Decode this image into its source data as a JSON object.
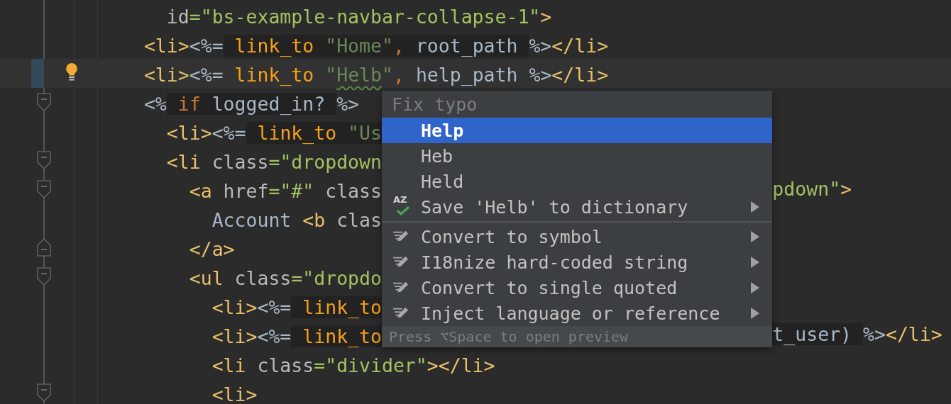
{
  "editor": {
    "lines": [
      {
        "current": false,
        "fold_open": false,
        "fold_close": false,
        "left": [
          {
            "text": "    id",
            "kind": "attr"
          },
          {
            "text": "=\"bs-example-navbar-collapse-1\"",
            "kind": "value"
          },
          {
            "text": ">",
            "kind": "tag"
          }
        ]
      },
      {
        "current": false,
        "fold_open": false,
        "fold_close": false,
        "left": [
          {
            "text": "  <li>",
            "kind": "tag"
          },
          {
            "text": "<%=",
            "kind": "punct"
          },
          {
            "text": " link_to",
            "kind": "ruby-method"
          },
          {
            "text": " \"Home\"",
            "kind": "ruby-string"
          },
          {
            "text": ",",
            "kind": "ruby-keyword"
          },
          {
            "text": " root_path ",
            "kind": "ruby-ident"
          },
          {
            "text": "%>",
            "kind": "punct"
          },
          {
            "text": "</li>",
            "kind": "tag"
          }
        ]
      },
      {
        "current": true,
        "fold_open": false,
        "fold_close": false,
        "left": [
          {
            "text": "  <li>",
            "kind": "tag"
          },
          {
            "text": "<%=",
            "kind": "punct"
          },
          {
            "text": " link_to",
            "kind": "method"
          },
          {
            "text": " \"",
            "kind": "string"
          },
          {
            "text": "Helb",
            "kind": "typo"
          },
          {
            "text": "\"",
            "kind": "string"
          },
          {
            "text": ",",
            "kind": "keyword"
          },
          {
            "text": " help_path ",
            "kind": "ident"
          },
          {
            "text": "%>",
            "kind": "punct"
          },
          {
            "text": "</li>",
            "kind": "tag"
          }
        ]
      },
      {
        "current": false,
        "fold_open": true,
        "fold_close": false,
        "left": [
          {
            "text": "  <%",
            "kind": "punct"
          },
          {
            "text": " if",
            "kind": "ruby-keyword"
          },
          {
            "text": " logged_in? ",
            "kind": "ruby-ident"
          },
          {
            "text": "%>",
            "kind": "punct"
          }
        ]
      },
      {
        "current": false,
        "fold_open": false,
        "fold_close": false,
        "left": [
          {
            "text": "    <li>",
            "kind": "tag"
          },
          {
            "text": "<%=",
            "kind": "punct"
          },
          {
            "text": " link_to",
            "kind": "ruby-method"
          },
          {
            "text": " \"Us",
            "kind": "ruby-string"
          }
        ]
      },
      {
        "current": false,
        "fold_open": true,
        "fold_close": false,
        "left": [
          {
            "text": "    <li",
            "kind": "tag"
          },
          {
            "text": " class",
            "kind": "attr"
          },
          {
            "text": "=\"dropdown",
            "kind": "value"
          }
        ]
      },
      {
        "current": false,
        "fold_open": true,
        "fold_close": false,
        "left": [
          {
            "text": "      <a",
            "kind": "tag"
          },
          {
            "text": " href",
            "kind": "attr"
          },
          {
            "text": "=\"#\"",
            "kind": "value"
          },
          {
            "text": " class",
            "kind": "attr"
          }
        ],
        "right": [
          {
            "text": "pdown\"",
            "kind": "value"
          },
          {
            "text": ">",
            "kind": "tag"
          }
        ]
      },
      {
        "current": false,
        "fold_open": false,
        "fold_close": false,
        "left": [
          {
            "text": "        Account",
            "kind": "ident"
          },
          {
            "text": " <b",
            "kind": "tag"
          },
          {
            "text": " clas",
            "kind": "attr"
          }
        ]
      },
      {
        "current": false,
        "fold_open": false,
        "fold_close": true,
        "left": [
          {
            "text": "      </a>",
            "kind": "tag"
          }
        ]
      },
      {
        "current": false,
        "fold_open": true,
        "fold_close": false,
        "left": [
          {
            "text": "      <ul",
            "kind": "tag"
          },
          {
            "text": " class",
            "kind": "attr"
          },
          {
            "text": "=\"dropdo",
            "kind": "value"
          }
        ]
      },
      {
        "current": false,
        "fold_open": false,
        "fold_close": false,
        "left": [
          {
            "text": "        <li>",
            "kind": "tag"
          },
          {
            "text": "<%=",
            "kind": "punct"
          },
          {
            "text": " link_to",
            "kind": "ruby-method"
          }
        ]
      },
      {
        "current": false,
        "fold_open": false,
        "fold_close": false,
        "left": [
          {
            "text": "        <li>",
            "kind": "tag"
          },
          {
            "text": "<%=",
            "kind": "punct"
          },
          {
            "text": " link_to",
            "kind": "ruby-method"
          }
        ],
        "right": [
          {
            "text": "t_user) ",
            "kind": "ruby-ident"
          },
          {
            "text": "%>",
            "kind": "punct"
          },
          {
            "text": "</li>",
            "kind": "tag"
          }
        ]
      },
      {
        "current": false,
        "fold_open": false,
        "fold_close": false,
        "left": [
          {
            "text": "        <li",
            "kind": "tag"
          },
          {
            "text": " class",
            "kind": "attr"
          },
          {
            "text": "=\"divider\"",
            "kind": "value"
          },
          {
            "text": "></li>",
            "kind": "tag"
          }
        ]
      },
      {
        "current": false,
        "fold_open": true,
        "fold_close": false,
        "left": [
          {
            "text": "        <li>",
            "kind": "tag"
          }
        ]
      }
    ]
  },
  "popup": {
    "title": "Fix typo",
    "groups": [
      {
        "items": [
          {
            "label": "Help",
            "kind": "suggestion",
            "selected": true,
            "submenu": false
          },
          {
            "label": "Heb",
            "kind": "suggestion",
            "selected": false,
            "submenu": false
          },
          {
            "label": "Held",
            "kind": "suggestion",
            "selected": false,
            "submenu": false
          },
          {
            "label": "Save 'Helb' to dictionary",
            "kind": "dictionary",
            "icon_label": "AZ",
            "selected": false,
            "submenu": true
          }
        ]
      },
      {
        "items": [
          {
            "label": "Convert to symbol",
            "kind": "intention",
            "selected": false,
            "submenu": true
          },
          {
            "label": "I18nize hard-coded string",
            "kind": "intention",
            "selected": false,
            "submenu": true
          },
          {
            "label": "Convert to single quoted",
            "kind": "intention",
            "selected": false,
            "submenu": true
          },
          {
            "label": "Inject language or reference",
            "kind": "intention",
            "selected": false,
            "submenu": true
          }
        ]
      }
    ],
    "footer": "Press ⌥Space to open preview"
  }
}
